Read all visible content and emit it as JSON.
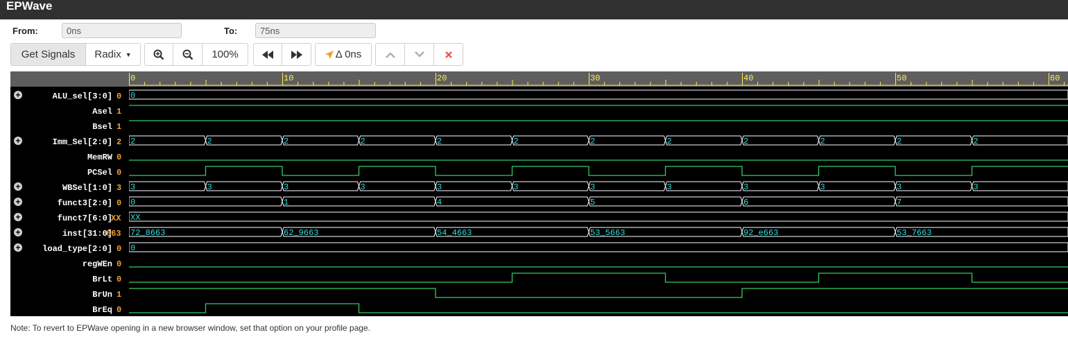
{
  "app": {
    "title": "EPWave"
  },
  "range": {
    "from_label": "From:",
    "from_value": "0ns",
    "to_label": "To:",
    "to_value": "75ns"
  },
  "toolbar": {
    "get_signals": "Get Signals",
    "radix": "Radix",
    "zoom_level": "100%",
    "delta": "Δ 0ns"
  },
  "ruler": {
    "start": 0,
    "end": 75,
    "pixels_per_ns": 22.1,
    "labels": [
      "0",
      "10",
      "20",
      "30",
      "40",
      "50",
      "60"
    ]
  },
  "signals": [
    {
      "name": "ALU_sel[3:0]",
      "value": "0",
      "bus": true,
      "expand": true,
      "segments": [
        {
          "t": 0,
          "v": "0"
        }
      ]
    },
    {
      "name": "Asel",
      "value": "1",
      "bus": false,
      "expand": false,
      "transitions": [
        {
          "t": 0,
          "v": 1
        }
      ]
    },
    {
      "name": "Bsel",
      "value": "1",
      "bus": false,
      "expand": false,
      "transitions": [
        {
          "t": 0,
          "v": 1
        }
      ]
    },
    {
      "name": "Imm_Sel[2:0]",
      "value": "2",
      "bus": true,
      "expand": true,
      "segments": [
        {
          "t": 0,
          "v": "2"
        },
        {
          "t": 5,
          "v": "2"
        },
        {
          "t": 10,
          "v": "2"
        },
        {
          "t": 15,
          "v": "2"
        },
        {
          "t": 20,
          "v": "2"
        },
        {
          "t": 25,
          "v": "2"
        },
        {
          "t": 30,
          "v": "2"
        },
        {
          "t": 35,
          "v": "2"
        },
        {
          "t": 40,
          "v": "2"
        },
        {
          "t": 45,
          "v": "2"
        },
        {
          "t": 50,
          "v": "2"
        },
        {
          "t": 55,
          "v": "2"
        }
      ]
    },
    {
      "name": "MemRW",
      "value": "0",
      "bus": false,
      "expand": false,
      "transitions": [
        {
          "t": 0,
          "v": 0
        }
      ]
    },
    {
      "name": "PCSel",
      "value": "0",
      "bus": false,
      "expand": false,
      "transitions": [
        {
          "t": 0,
          "v": 0
        },
        {
          "t": 5,
          "v": 1
        },
        {
          "t": 10,
          "v": 0
        },
        {
          "t": 15,
          "v": 1
        },
        {
          "t": 20,
          "v": 0
        },
        {
          "t": 25,
          "v": 1
        },
        {
          "t": 30,
          "v": 0
        },
        {
          "t": 35,
          "v": 1
        },
        {
          "t": 40,
          "v": 0
        },
        {
          "t": 45,
          "v": 1
        },
        {
          "t": 50,
          "v": 0
        },
        {
          "t": 55,
          "v": 1
        }
      ]
    },
    {
      "name": "WBSel[1:0]",
      "value": "3",
      "bus": true,
      "expand": true,
      "segments": [
        {
          "t": 0,
          "v": "3"
        },
        {
          "t": 5,
          "v": "3"
        },
        {
          "t": 10,
          "v": "3"
        },
        {
          "t": 15,
          "v": "3"
        },
        {
          "t": 20,
          "v": "3"
        },
        {
          "t": 25,
          "v": "3"
        },
        {
          "t": 30,
          "v": "3"
        },
        {
          "t": 35,
          "v": "3"
        },
        {
          "t": 40,
          "v": "3"
        },
        {
          "t": 45,
          "v": "3"
        },
        {
          "t": 50,
          "v": "3"
        },
        {
          "t": 55,
          "v": "3"
        }
      ]
    },
    {
      "name": "funct3[2:0]",
      "value": "0",
      "bus": true,
      "expand": true,
      "segments": [
        {
          "t": 0,
          "v": "0"
        },
        {
          "t": 10,
          "v": "1"
        },
        {
          "t": 20,
          "v": "4"
        },
        {
          "t": 30,
          "v": "5"
        },
        {
          "t": 40,
          "v": "6"
        },
        {
          "t": 50,
          "v": "7"
        }
      ]
    },
    {
      "name": "funct7[6:0]",
      "value": "XX",
      "bus": true,
      "expand": true,
      "segments": [
        {
          "t": 0,
          "v": "XX"
        }
      ]
    },
    {
      "name": "inst[31:0]",
      "value": "663",
      "bus": true,
      "expand": true,
      "segments": [
        {
          "t": 0,
          "v": "72_8663"
        },
        {
          "t": 10,
          "v": "62_9663"
        },
        {
          "t": 20,
          "v": "54_4663"
        },
        {
          "t": 30,
          "v": "53_5663"
        },
        {
          "t": 40,
          "v": "92_e663"
        },
        {
          "t": 50,
          "v": "53_7663"
        }
      ]
    },
    {
      "name": "load_type[2:0]",
      "value": "0",
      "bus": true,
      "expand": true,
      "segments": [
        {
          "t": 0,
          "v": "0"
        }
      ]
    },
    {
      "name": "regWEn",
      "value": "0",
      "bus": false,
      "expand": false,
      "transitions": [
        {
          "t": 0,
          "v": 0
        }
      ]
    },
    {
      "name": "BrLt",
      "value": "0",
      "bus": false,
      "expand": false,
      "transitions": [
        {
          "t": 0,
          "v": 0
        },
        {
          "t": 25,
          "v": 1
        },
        {
          "t": 35,
          "v": 0
        },
        {
          "t": 45,
          "v": 1
        },
        {
          "t": 55,
          "v": 0
        }
      ]
    },
    {
      "name": "BrUn",
      "value": "1",
      "bus": false,
      "expand": false,
      "transitions": [
        {
          "t": 0,
          "v": 1
        },
        {
          "t": 20,
          "v": 0
        },
        {
          "t": 40,
          "v": 1
        }
      ]
    },
    {
      "name": "BrEq",
      "value": "0",
      "bus": false,
      "expand": false,
      "transitions": [
        {
          "t": 0,
          "v": 0
        },
        {
          "t": 5,
          "v": 1
        },
        {
          "t": 15,
          "v": 0
        }
      ]
    }
  ],
  "colors": {
    "bus": "#ffffff",
    "bit": "#33cc66",
    "bus_text": "#33dddd",
    "ruler_text": "#ffee55",
    "value": "#f0a030"
  },
  "footer": {
    "note": "Note: To revert to EPWave opening in a new browser window, set that option on your profile page."
  }
}
